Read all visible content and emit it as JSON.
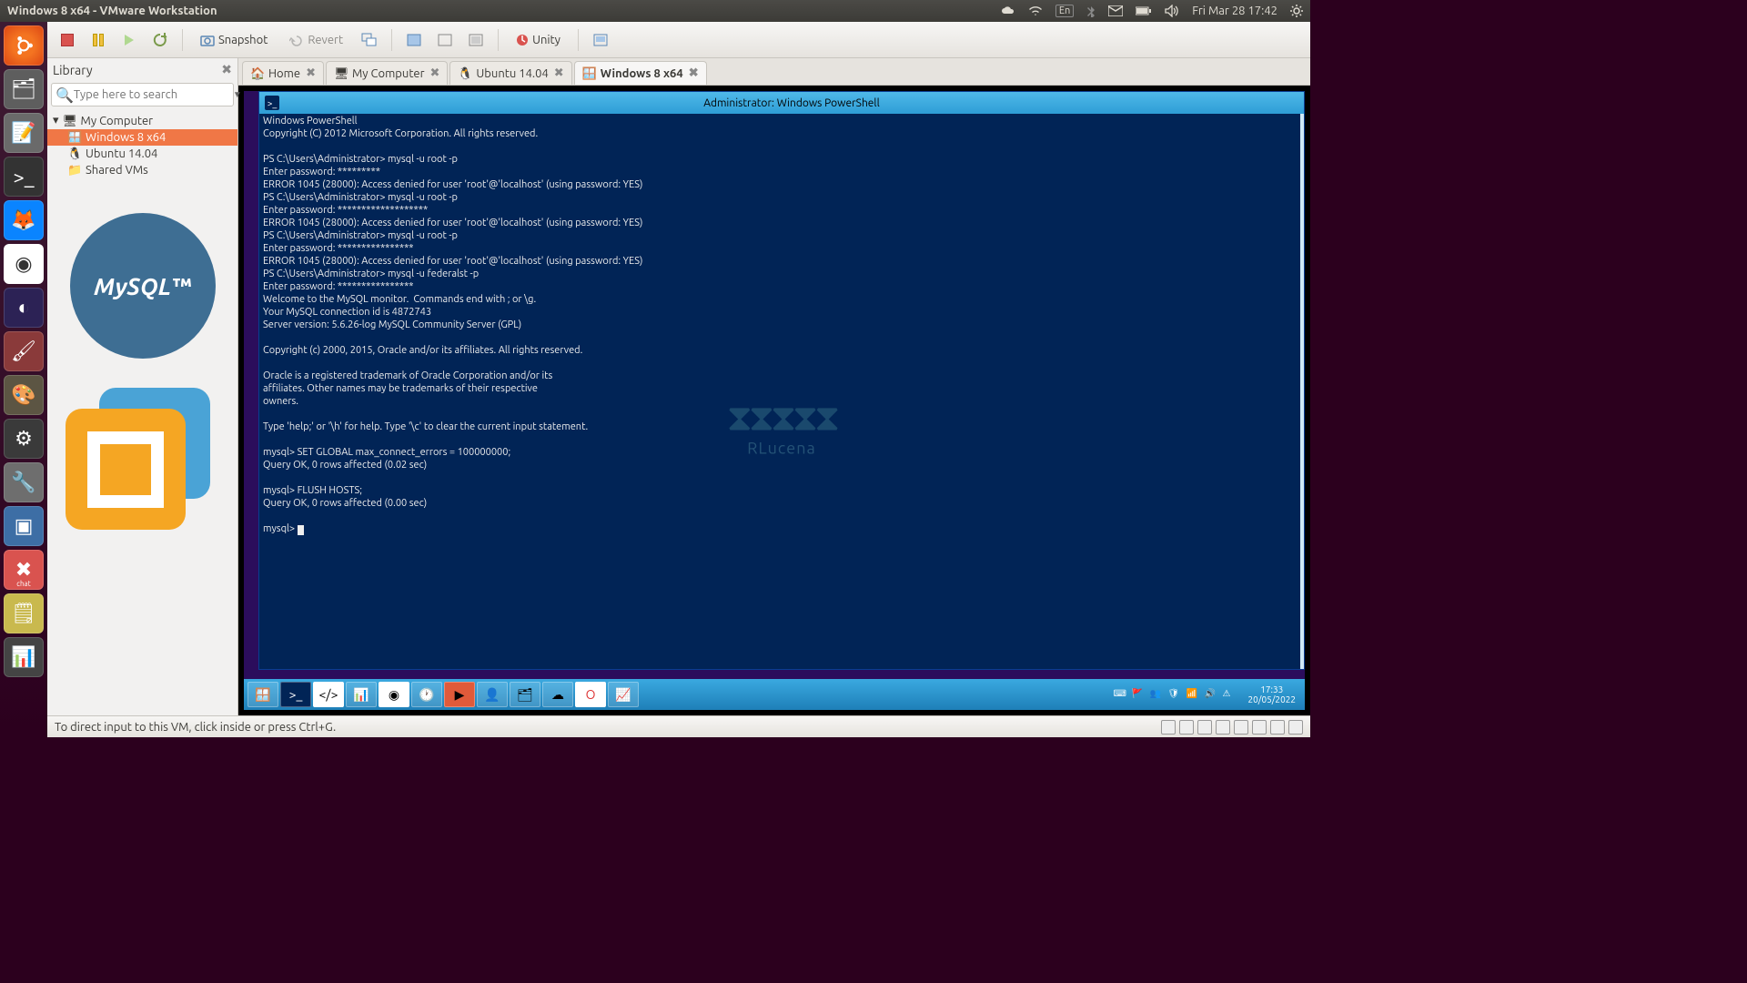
{
  "menubar": {
    "title": "Windows 8 x64 - VMware Workstation",
    "lang": "En",
    "clock": "Fri Mar 28 17:42"
  },
  "toolbar": {
    "snapshot": "Snapshot",
    "revert": "Revert",
    "unity": "Unity"
  },
  "library": {
    "title": "Library",
    "search_placeholder": "Type here to search",
    "nodes": {
      "root": "My Computer",
      "vm1": "Windows 8 x64",
      "vm2": "Ubuntu 14.04",
      "shared": "Shared VMs"
    }
  },
  "logos": {
    "mysql": "MySQL™"
  },
  "tabs": {
    "home": "Home",
    "mycomputer": "My Computer",
    "ubuntu": "Ubuntu 14.04",
    "win8": "Windows 8 x64"
  },
  "powershell": {
    "title": "Administrator: Windows PowerShell",
    "lines": "Windows PowerShell\nCopyright (C) 2012 Microsoft Corporation. All rights reserved.\n\nPS C:\\Users\\Administrator> mysql -u root -p\nEnter password: *********\nERROR 1045 (28000): Access denied for user 'root'@'localhost' (using password: YES)\nPS C:\\Users\\Administrator> mysql -u root -p\nEnter password: *******************\nERROR 1045 (28000): Access denied for user 'root'@'localhost' (using password: YES)\nPS C:\\Users\\Administrator> mysql -u root -p\nEnter password: ****************\nERROR 1045 (28000): Access denied for user 'root'@'localhost' (using password: YES)\nPS C:\\Users\\Administrator> mysql -u federalst -p\nEnter password: ****************\nWelcome to the MySQL monitor.  Commands end with ; or \\g.\nYour MySQL connection id is 4872743\nServer version: 5.6.26-log MySQL Community Server (GPL)\n\nCopyright (c) 2000, 2015, Oracle and/or its affiliates. All rights reserved.\n\nOracle is a registered trademark of Oracle Corporation and/or its\naffiliates. Other names may be trademarks of their respective\nowners.\n\nType 'help;' or '\\h' for help. Type '\\c' to clear the current input statement.\n\nmysql> SET GLOBAL max_connect_errors = 100000000;\nQuery OK, 0 rows affected (0.02 sec)\n\nmysql> FLUSH HOSTS;\nQuery OK, 0 rows affected (0.00 sec)\n\nmysql> "
  },
  "watermark": {
    "text": "RLucena"
  },
  "win_taskbar": {
    "time": "17:33",
    "date": "20/05/2022"
  },
  "statusbar": {
    "hint": "To direct input to this VM, click inside or press Ctrl+G."
  }
}
